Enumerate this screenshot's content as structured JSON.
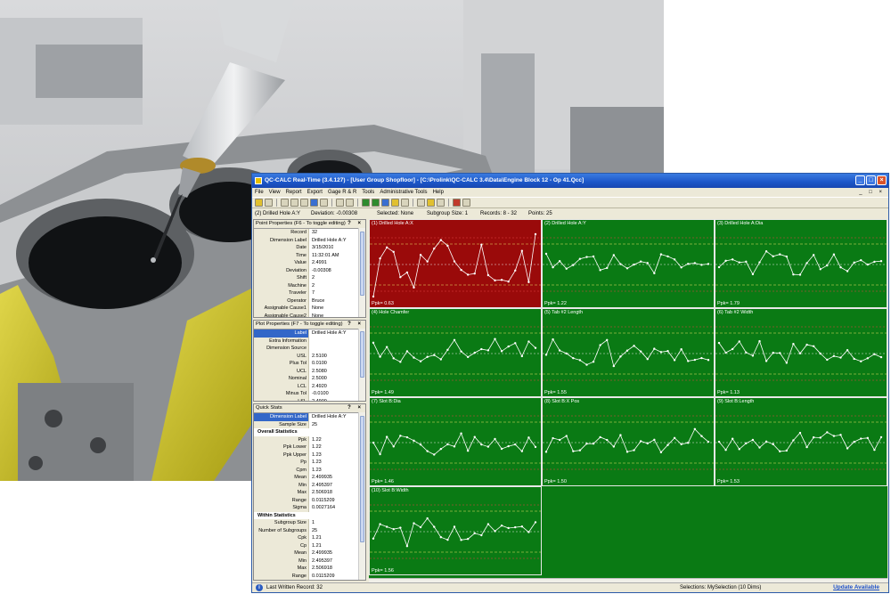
{
  "window": {
    "title": "QC-CALC Real-Time (3.4.127) - [User Group Shopfloor] - [C:\\Prolink\\QC-CALC 3.4\\Data\\Engine Block 12 - Op 41.Qcc]"
  },
  "menu": [
    "File",
    "View",
    "Report",
    "Export",
    "Gage R & R",
    "Tools",
    "Administrative Tools",
    "Help"
  ],
  "info_bar": {
    "dimension": "(2) Drilled Hole A:Y",
    "deviation": "Deviation: -0.00308",
    "selected": "Selected: None",
    "subgroup": "Subgroup Size: 1",
    "records": "Records: 8 - 32",
    "points": "Points: 25"
  },
  "point_properties": {
    "header": "Point Properties (F6 - To toggle editing)",
    "rows": [
      {
        "k": "Record",
        "v": "32"
      },
      {
        "k": "Dimension Label",
        "v": "Drilled Hole A:Y"
      },
      {
        "k": "Date",
        "v": "3/15/2010"
      },
      {
        "k": "Time",
        "v": "11:32:01 AM"
      },
      {
        "k": "Value",
        "v": "2.4991"
      },
      {
        "k": "Deviation",
        "v": "-0.00308"
      },
      {
        "k": "Shift",
        "v": "2"
      },
      {
        "k": "Machine",
        "v": "2"
      },
      {
        "k": "Traveler",
        "v": "7"
      },
      {
        "k": "Operator",
        "v": "Bruce"
      },
      {
        "k": "Assignable Cause1",
        "v": "None"
      },
      {
        "k": "Assignable Cause2",
        "v": "None"
      }
    ]
  },
  "plot_properties": {
    "header": "Plot Properties (F7 - To toggle editing)",
    "rows": [
      {
        "k": "Label",
        "v": "Drilled Hole A:Y"
      },
      {
        "k": "Extra Information",
        "v": ""
      },
      {
        "k": "Dimension Source",
        "v": ""
      },
      {
        "k": "USL",
        "v": "2.5100"
      },
      {
        "k": "Plus Tol",
        "v": "0.0100"
      },
      {
        "k": "UCL",
        "v": "2.5080"
      },
      {
        "k": "Nominal",
        "v": "2.5000"
      },
      {
        "k": "LCL",
        "v": "2.4920"
      },
      {
        "k": "Minus Tol",
        "v": "-0.0100"
      },
      {
        "k": "LSL",
        "v": "2.4900"
      }
    ]
  },
  "quick_stats": {
    "header": "Quick Stats",
    "rows": [
      {
        "k": "Dimension Label",
        "v": "Drilled Hole A:Y"
      },
      {
        "k": "Sample Size",
        "v": "25"
      },
      {
        "k": "Overall Statistics",
        "v": "",
        "cat": true
      },
      {
        "k": "Ppk",
        "v": "1.22"
      },
      {
        "k": "Ppk Lower",
        "v": "1.22"
      },
      {
        "k": "Ppk Upper",
        "v": "1.23"
      },
      {
        "k": "Pp",
        "v": "1.23"
      },
      {
        "k": "Cpm",
        "v": "1.23"
      },
      {
        "k": "Mean",
        "v": "2.499935"
      },
      {
        "k": "Min",
        "v": "2.495397"
      },
      {
        "k": "Max",
        "v": "2.506918"
      },
      {
        "k": "Range",
        "v": "0.0115209"
      },
      {
        "k": "Sigma",
        "v": "0.0027164"
      },
      {
        "k": "Within Statistics",
        "v": "",
        "cat": true
      },
      {
        "k": "Subgroup Size",
        "v": "1"
      },
      {
        "k": "Number of Subgroups",
        "v": "25"
      },
      {
        "k": "Cpk",
        "v": "1.21"
      },
      {
        "k": "Cp",
        "v": "1.21"
      },
      {
        "k": "Mean",
        "v": "2.499935"
      },
      {
        "k": "Min",
        "v": "2.495397"
      },
      {
        "k": "Max",
        "v": "2.506918"
      },
      {
        "k": "Range",
        "v": "0.0115209"
      }
    ]
  },
  "charts": [
    {
      "label": "(1) Drilled Hole A:X",
      "pk": "Ppk= 0.63",
      "alarm": true
    },
    {
      "label": "(2) Drilled Hole A:Y",
      "pk": "Ppk= 1.22",
      "alarm": false
    },
    {
      "label": "(3) Drilled Hole A:Dia",
      "pk": "Ppk= 1.79",
      "alarm": false
    },
    {
      "label": "(4) Hole Chamfer",
      "pk": "Ppk= 1.49",
      "alarm": false
    },
    {
      "label": "(5) Tab #2 Length",
      "pk": "Ppk= 1.55",
      "alarm": false
    },
    {
      "label": "(6) Tab #2 Width",
      "pk": "Ppk= 1.13",
      "alarm": false
    },
    {
      "label": "(7) Slot B:Dia",
      "pk": "Ppk= 1.46",
      "alarm": false
    },
    {
      "label": "(8) Slot B:X Pos",
      "pk": "Ppk= 1.50",
      "alarm": false
    },
    {
      "label": "(9) Slot B:Length",
      "pk": "Ppk= 1.53",
      "alarm": false
    },
    {
      "label": "(10) Slot B:Width",
      "pk": "Ppk= 1.56",
      "alarm": false
    }
  ],
  "colors": {
    "ok": "#0a7a14",
    "alarm": "#9a0a0a"
  },
  "statusbar": {
    "last_written": "Last Written Record: 32",
    "selections": "Selections: MySelection (10 Dims)",
    "update": "Update Available"
  }
}
